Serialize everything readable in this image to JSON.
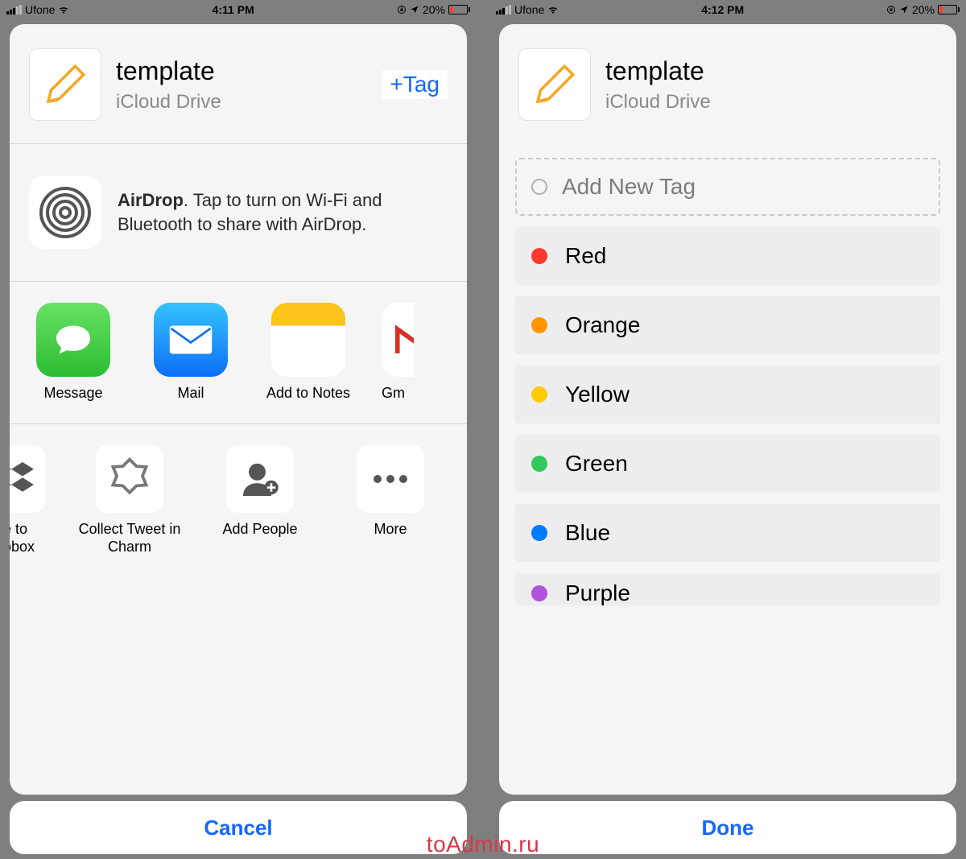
{
  "left": {
    "status": {
      "carrier": "Ufone",
      "time": "4:11 PM",
      "battery_pct": "20%"
    },
    "file": {
      "title": "template",
      "subtitle": "iCloud Drive",
      "tag_btn": "+Tag"
    },
    "airdrop": {
      "bold": "AirDrop",
      "rest": ". Tap to turn on Wi-Fi and Bluetooth to share with AirDrop."
    },
    "apps": {
      "message": "Message",
      "mail": "Mail",
      "notes": "Add to Notes",
      "gmail": "Gm"
    },
    "actions": {
      "dropbox": "e to\nobox",
      "charm": "Collect Tweet in Charm",
      "addpeople": "Add People",
      "more": "More"
    },
    "cancel": "Cancel"
  },
  "right": {
    "status": {
      "carrier": "Ufone",
      "time": "4:12 PM",
      "battery_pct": "20%"
    },
    "file": {
      "title": "template",
      "subtitle": "iCloud Drive"
    },
    "add_tag": "Add New Tag",
    "tags": [
      {
        "name": "Red",
        "color": "#ff3b30"
      },
      {
        "name": "Orange",
        "color": "#ff9500"
      },
      {
        "name": "Yellow",
        "color": "#ffcc00"
      },
      {
        "name": "Green",
        "color": "#34c759"
      },
      {
        "name": "Blue",
        "color": "#007aff"
      },
      {
        "name": "Purple",
        "color": "#af52de"
      }
    ],
    "done": "Done"
  },
  "watermark": "toAdmin.ru"
}
